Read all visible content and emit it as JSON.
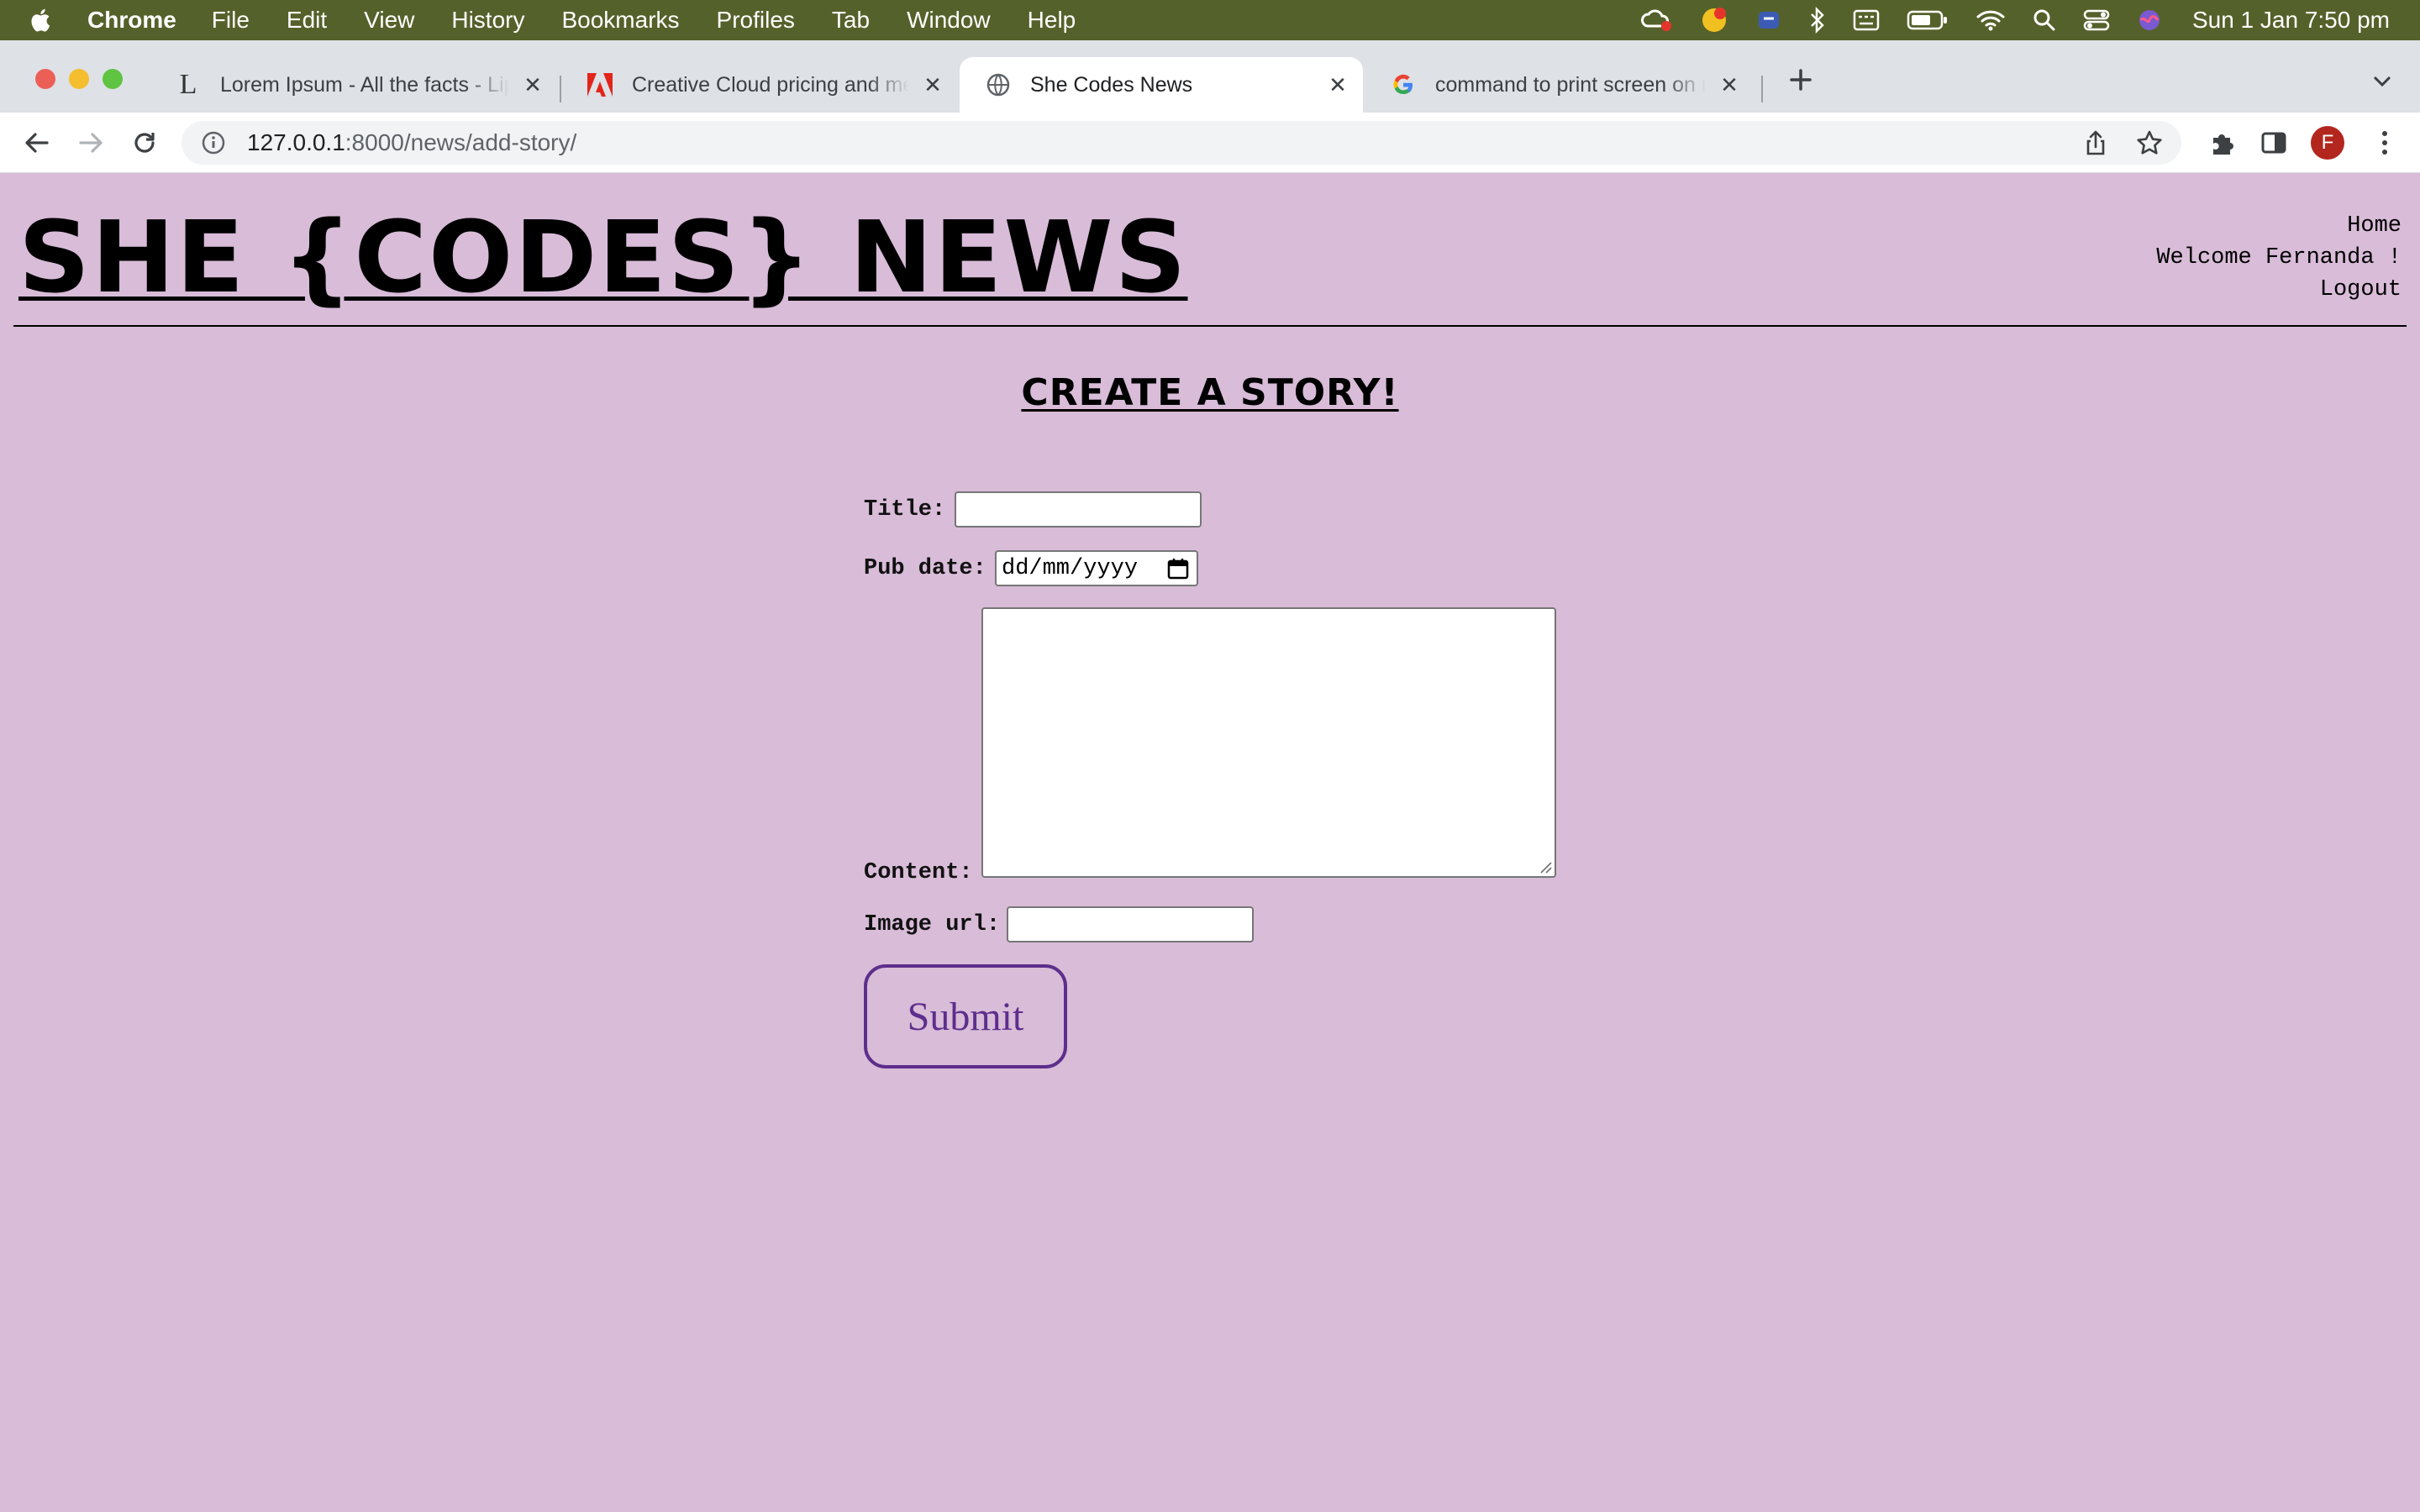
{
  "menubar": {
    "app_name": "Chrome",
    "items": [
      "File",
      "Edit",
      "View",
      "History",
      "Bookmarks",
      "Profiles",
      "Tab",
      "Window",
      "Help"
    ],
    "clock": "Sun 1 Jan  7:50 pm"
  },
  "tabs": [
    {
      "title": "Lorem Ipsum - All the facts - Lipsum generator",
      "favicon": "L"
    },
    {
      "title": "Creative Cloud pricing and membership plans",
      "favicon": "adobe"
    },
    {
      "title": "She Codes News",
      "favicon": "globe"
    },
    {
      "title": "command to print screen on mac - Google Search",
      "favicon": "G"
    }
  ],
  "address_bar": {
    "host": "127.0.0.1",
    "path": ":8000/news/add-story/"
  },
  "profile_initial": "F",
  "site": {
    "title": "SHE {CODES} NEWS",
    "nav": {
      "home": "Home",
      "welcome": "Welcome Fernanda !",
      "logout": "Logout"
    }
  },
  "form": {
    "heading": "CREATE A STORY!",
    "title_label": "Title:",
    "pub_date_label": "Pub date:",
    "pub_date_placeholder": "dd/mm/yyyy",
    "content_label": "Content:",
    "image_url_label": "Image url:",
    "submit_label": "Submit"
  },
  "colors": {
    "page_background": "#d8bcd8",
    "menubar": "#55612a",
    "submit_accent": "#5d2e8c"
  }
}
